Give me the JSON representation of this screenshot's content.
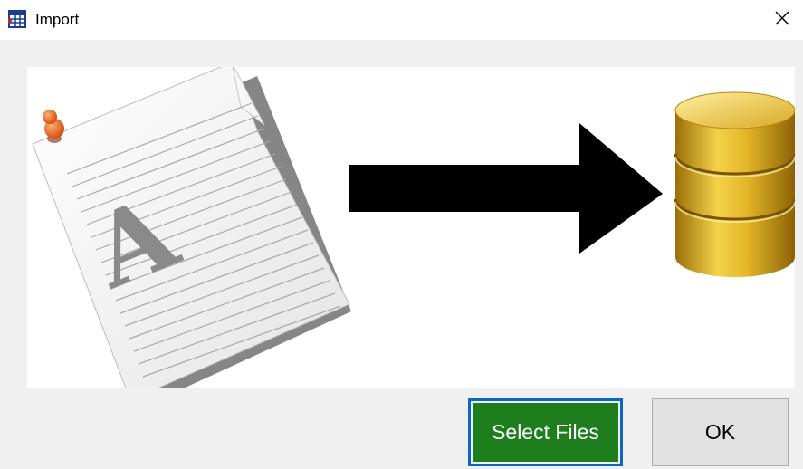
{
  "window": {
    "title": "Import",
    "close_glyph": "✕"
  },
  "icons": {
    "title": "table-import-icon",
    "close": "close-icon",
    "document": "document-icon",
    "arrow": "right-arrow-icon",
    "database": "database-icon"
  },
  "banner": {
    "document_letter": "A"
  },
  "buttons": {
    "select_files": "Select Files",
    "ok": "OK"
  },
  "colors": {
    "select_files_bg": "#1e7e1e",
    "focus_border": "#0b67c7",
    "dialog_bg": "#f0f0f0"
  }
}
